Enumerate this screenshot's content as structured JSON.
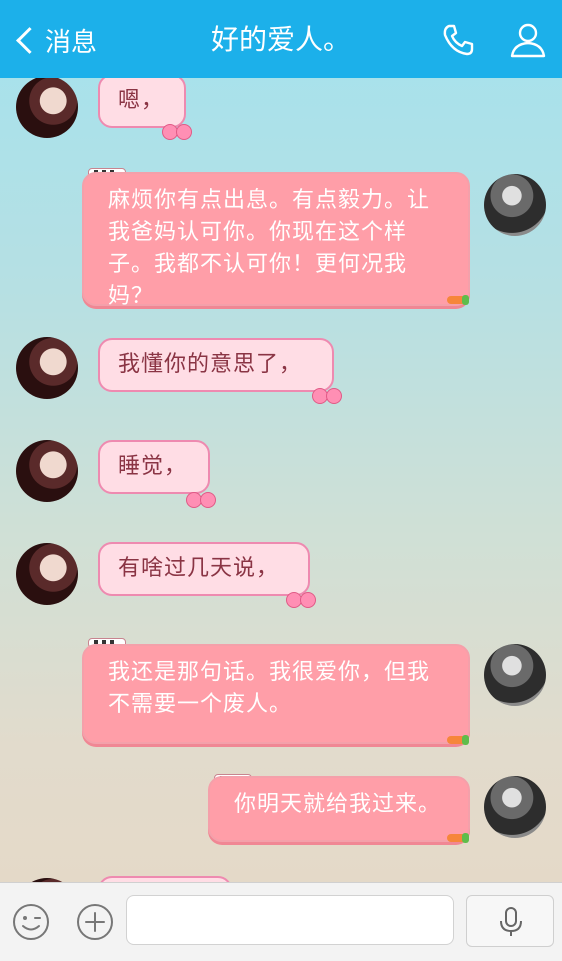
{
  "header": {
    "back_label": "消息",
    "title": "好的爱人。",
    "call_icon": "phone-icon",
    "profile_icon": "contact-icon"
  },
  "messages": [
    {
      "side": "left",
      "text": "嗯，"
    },
    {
      "side": "right",
      "text": "麻烦你有点出息。有点毅力。让我爸妈认可你。你现在这个样子。我都不认可你！更何况我妈？"
    },
    {
      "side": "left",
      "text": "我懂你的意思了，"
    },
    {
      "side": "left",
      "text": "睡觉，"
    },
    {
      "side": "left",
      "text": "有啥过几天说，"
    },
    {
      "side": "right",
      "text": "我还是那句话。我很爱你，但我不需要一个废人。"
    },
    {
      "side": "right",
      "text": "你明天就给我过来。"
    }
  ],
  "input": {
    "value": "",
    "placeholder": ""
  },
  "colors": {
    "header": "#1cb0ea",
    "left_bubble": "#ffdde5",
    "right_bubble": "#ff9ea8"
  }
}
